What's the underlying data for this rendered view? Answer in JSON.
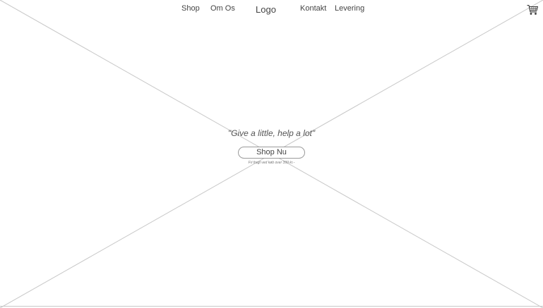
{
  "nav": {
    "left_links": [
      "Shop",
      "Om Os"
    ],
    "logo": "Logo",
    "right_links": [
      "Kontakt",
      "Levering"
    ],
    "cart_icon": "shopping-cart-icon"
  },
  "hero": {
    "tagline": "\"Give a little, help a lot\"",
    "cta_label": "Shop Nu",
    "note": "Fri fragt ved køb over 399 kr.-"
  },
  "colors": {
    "background": "#ffffff",
    "wireframe_line": "#c8c8c8",
    "text": "#444444"
  }
}
